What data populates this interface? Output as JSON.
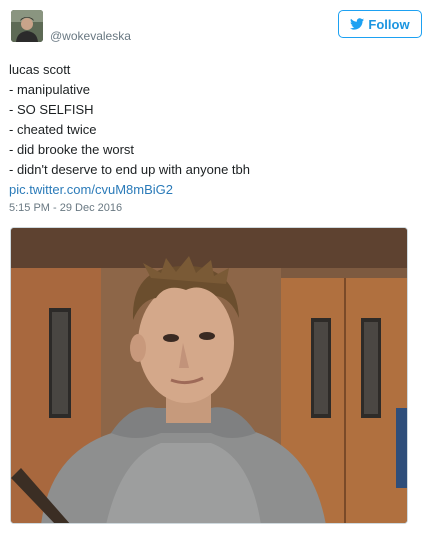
{
  "tweet": {
    "handle": "@wokevaleska",
    "follow_label": "Follow",
    "follow_icon": "twitter-bird-icon",
    "text_lines": [
      "lucas scott",
      "- manipulative",
      "- SO SELFISH",
      "- cheated twice",
      "- did brooke the worst",
      "- didn't deserve to end up with anyone tbh"
    ],
    "link": "pic.twitter.com/cvuM8mBiG2",
    "timestamp": "5:15 PM - 29 Dec 2016"
  },
  "colors": {
    "accent": "#1da1f2",
    "link": "#2b7bb9",
    "muted": "#697882",
    "text": "#1c2022"
  }
}
